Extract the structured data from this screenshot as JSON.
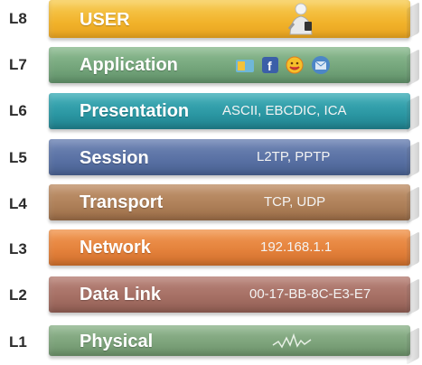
{
  "layers": [
    {
      "level": "L8",
      "name": "USER",
      "example": "",
      "color": "#f3b82e",
      "icons": [
        "user-figure-icon"
      ]
    },
    {
      "level": "L7",
      "name": "Application",
      "example": "",
      "color": "#78a87e",
      "icons": [
        "app-icon-1",
        "facebook-icon",
        "smiley-icon",
        "mail-icon"
      ]
    },
    {
      "level": "L6",
      "name": "Presentation",
      "example": "ASCII, EBCDIC, ICA",
      "color": "#2c9aa6"
    },
    {
      "level": "L5",
      "name": "Session",
      "example": "L2TP, PPTP",
      "color": "#5b73a6"
    },
    {
      "level": "L4",
      "name": "Transport",
      "example": "TCP, UDP",
      "color": "#b0805a"
    },
    {
      "level": "L3",
      "name": "Network",
      "example": "192.168.1.1",
      "color": "#e5823a"
    },
    {
      "level": "L2",
      "name": "Data Link",
      "example": "00-17-BB-8C-E3-E7",
      "color": "#a76f63"
    },
    {
      "level": "L1",
      "name": "Physical",
      "example": "",
      "color": "#7ea37c",
      "icons": [
        "signal-wave-icon"
      ]
    }
  ]
}
